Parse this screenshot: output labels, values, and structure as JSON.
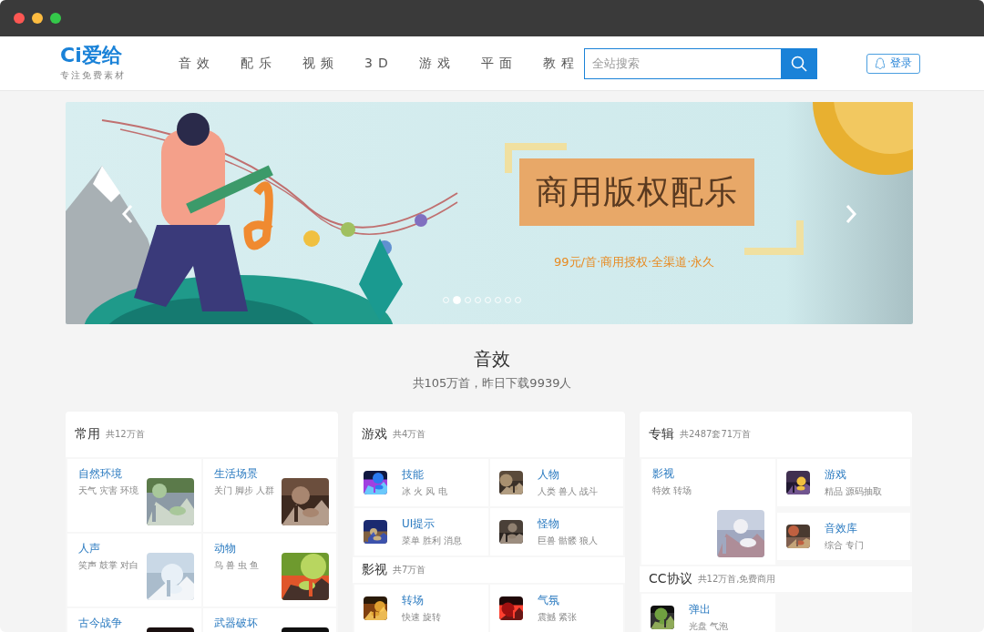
{
  "header": {
    "logo": "Ci爱给",
    "tagline": "专注免费素材",
    "nav": [
      {
        "label": "音效"
      },
      {
        "label": "配乐"
      },
      {
        "label": "视频"
      },
      {
        "label": "3D"
      },
      {
        "label": "游戏"
      },
      {
        "label": "平面"
      },
      {
        "label": "教程"
      }
    ],
    "search": {
      "placeholder": "全站搜索"
    },
    "login": "登录"
  },
  "banner": {
    "title": "商用版权配乐",
    "subtitle": "99元/首·商用授权·全渠道·永久",
    "dots": [
      {
        "selected": false
      },
      {
        "selected": true
      },
      {
        "selected": false
      },
      {
        "selected": false
      },
      {
        "selected": false
      },
      {
        "selected": false
      },
      {
        "selected": false
      },
      {
        "selected": false
      }
    ]
  },
  "section": {
    "title": "音效",
    "subtitle": "共105万首，昨日下载9939人"
  },
  "cards": [
    {
      "groups": [
        {
          "title": "常用",
          "count": "共12万首",
          "items": [
            {
              "kind": "tile",
              "title": "自然环境",
              "tags": "天气 灾害 环境"
            },
            {
              "kind": "tile",
              "title": "生活场景",
              "tags": "关门 脚步 人群"
            },
            {
              "kind": "tile",
              "title": "人声",
              "tags": "笑声 鼓掌 对白"
            },
            {
              "kind": "tile",
              "title": "动物",
              "tags": "鸟 兽 虫 鱼"
            },
            {
              "kind": "tile",
              "title": "古今战争"
            },
            {
              "kind": "tile",
              "title": "武器破坏"
            }
          ]
        }
      ]
    },
    {
      "groups": [
        {
          "title": "游戏",
          "count": "共4万首",
          "items": [
            {
              "kind": "icon",
              "title": "技能",
              "tags": "冰 火 风 电"
            },
            {
              "kind": "icon",
              "title": "人物",
              "tags": "人类 兽人 战斗"
            },
            {
              "kind": "icon",
              "title": "UI提示",
              "tags": "菜单 胜利 消息"
            },
            {
              "kind": "icon",
              "title": "怪物",
              "tags": "巨兽 骷髅 狼人"
            }
          ]
        },
        {
          "title": "影视",
          "count": "共7万首",
          "items": [
            {
              "kind": "icon",
              "title": "转场",
              "tags": "快速 旋转"
            },
            {
              "kind": "icon",
              "title": "气氛",
              "tags": "震撼 紧张"
            }
          ]
        }
      ]
    },
    {
      "groups": [
        {
          "title": "专辑",
          "count": "共2487套71万首",
          "items": [
            {
              "kind": "feature",
              "title": "影视",
              "tags": "特效 转场"
            },
            {
              "kind": "icon",
              "title": "游戏",
              "tags": "精品 源码抽取"
            },
            {
              "kind": "icon",
              "title": "音效库",
              "tags": "综合 专门"
            }
          ]
        },
        {
          "title": "CC协议",
          "count": "共12万首,免费商用",
          "items": [
            {
              "kind": "icon",
              "title": "弹出",
              "tags": "光盘 气泡"
            }
          ]
        }
      ]
    }
  ]
}
